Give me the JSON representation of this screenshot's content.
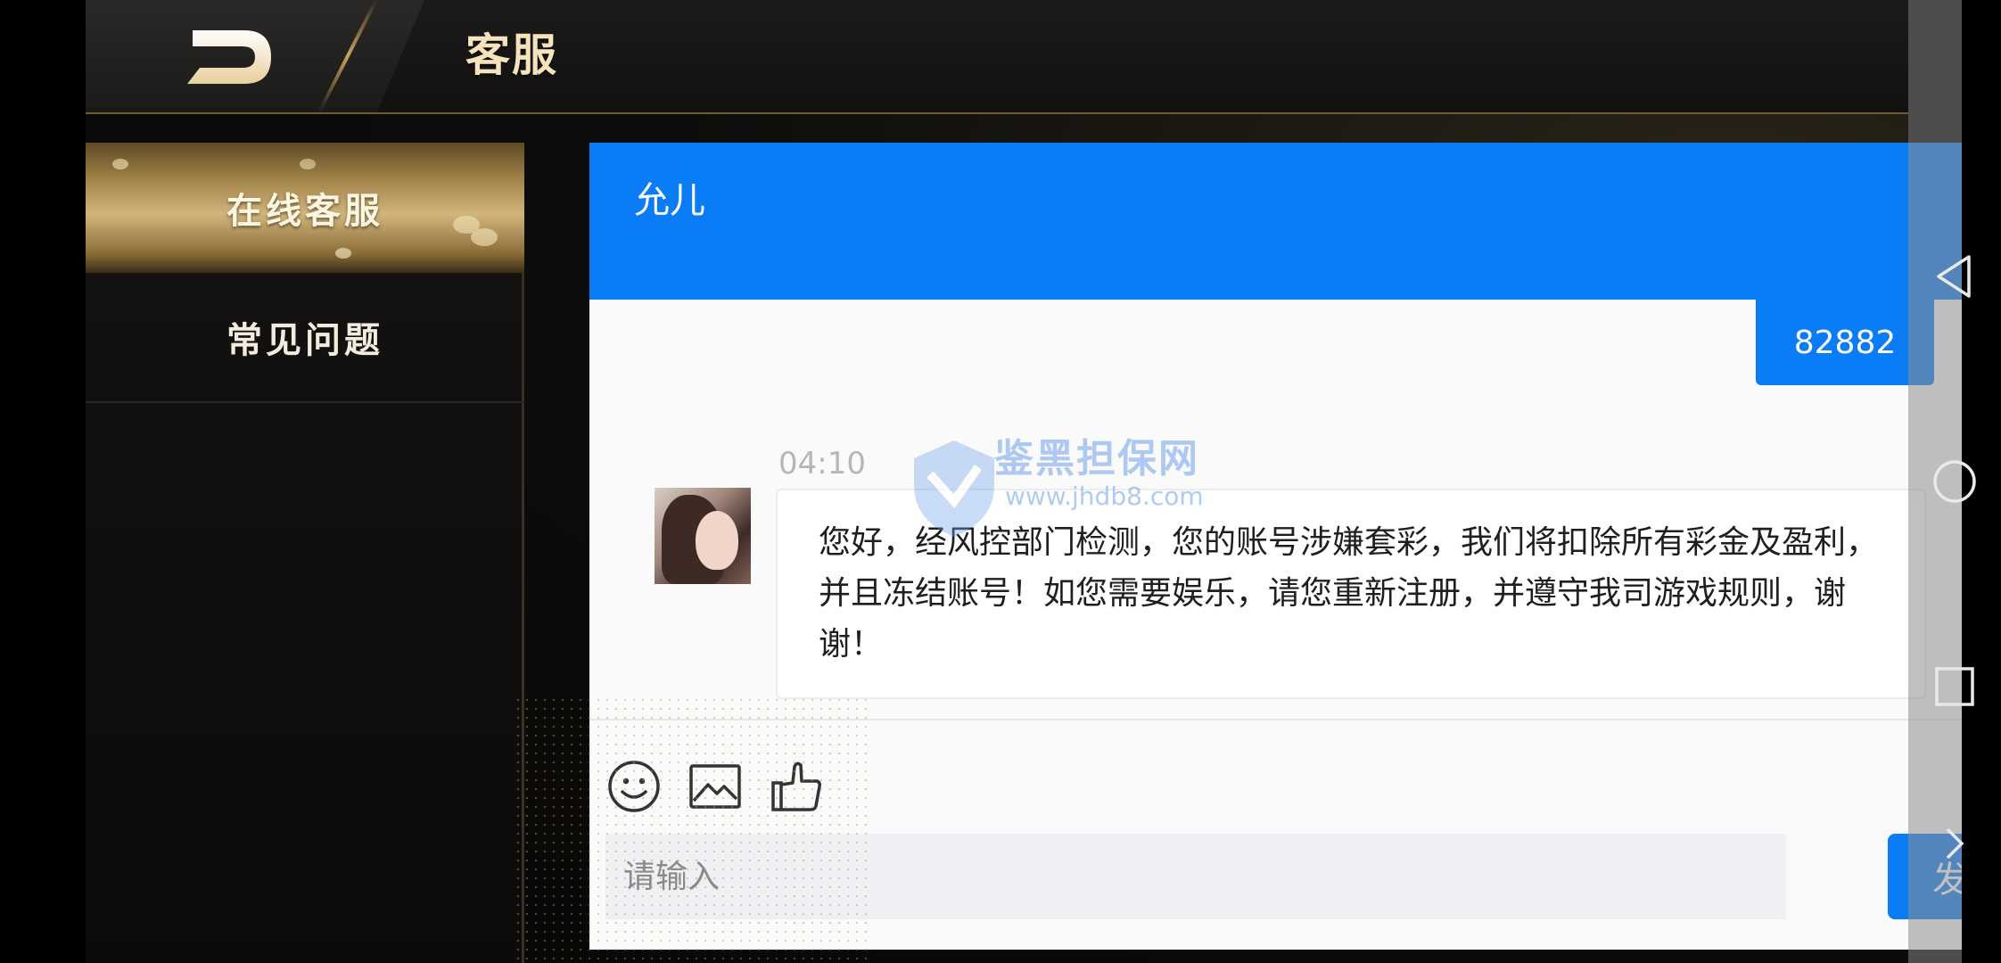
{
  "header": {
    "title": "客服"
  },
  "sidebar": {
    "items": [
      {
        "label": "在线客服",
        "active": true
      },
      {
        "label": "常见问题",
        "active": false
      }
    ]
  },
  "chat": {
    "agent_name": "允儿",
    "outgoing_message": "82882",
    "timestamp": "04:10",
    "incoming_message": "您好，经风控部门检测，您的账号涉嫌套彩，我们将扣除所有彩金及盈利，并且冻结账号！如您需要娱乐，请您重新注册，并遵守我司游戏规则，谢谢！",
    "input_placeholder": "请输入",
    "send_label": "发送",
    "toolbar_icons": [
      "emoji-icon",
      "image-icon",
      "thumbs-up-icon"
    ]
  },
  "watermark": {
    "text": "鉴黑担保网",
    "url": "www.jhdb8.com"
  },
  "colors": {
    "primary": "#0a7cf5",
    "gold": "#c9a35a"
  },
  "system_nav": [
    "back-triangle-icon",
    "home-circle-icon",
    "recents-square-icon",
    "chevron-right-icon"
  ]
}
